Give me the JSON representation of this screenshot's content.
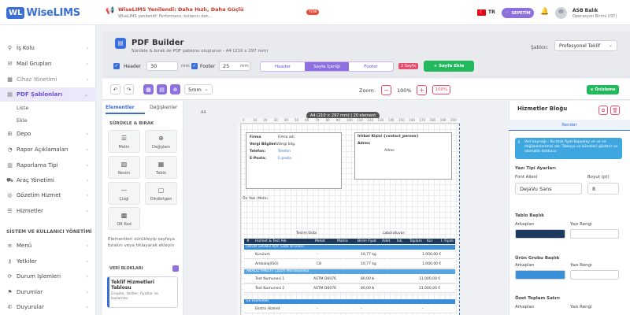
{
  "topbar": {
    "logo_wl": "WL",
    "logo_name": "WiseLIMS",
    "announce_title": "WiseLIMS Yenilendi: Daha Hızlı, Daha Güçlü",
    "announce_sub": "WiseLIMS yenilendi! Performans, kullanıcı den...",
    "new_badge": "YENİ",
    "lang_flag": "☾",
    "lang": "TR",
    "basket_label": "SEPETİM",
    "user_name": "ASB Balık",
    "user_role": "Operasyon Birimi (IST)"
  },
  "sidebar": {
    "items": [
      {
        "icon": "⚲",
        "label": "İş Kolu"
      },
      {
        "icon": "✉",
        "label": "Mail Grupları"
      },
      {
        "icon": "▦",
        "label": "Cihaz Yönetimi"
      },
      {
        "icon": "▤",
        "label": "PDF Şablonları"
      },
      {
        "icon": "⊞",
        "label": "Depo"
      },
      {
        "icon": "◔",
        "label": "Rapor Açıklamaları"
      },
      {
        "icon": "▥",
        "label": "Raporlama Tipi"
      },
      {
        "icon": "⛟",
        "label": "Araç Yönetimi"
      },
      {
        "icon": "◎",
        "label": "Gözetim Hizmet"
      },
      {
        "icon": "☰",
        "label": "Hizmetler"
      },
      {
        "icon": "≡",
        "label": "Menü"
      },
      {
        "icon": "⚷",
        "label": "Yetkiler"
      },
      {
        "icon": "⟳",
        "label": "Durum İşlemleri"
      },
      {
        "icon": "⚑",
        "label": "Durumlar"
      },
      {
        "icon": "✆",
        "label": "Duyurular"
      }
    ],
    "sub_items": [
      "Liste",
      "Ekle"
    ],
    "section": "SİSTEM VE KULLANICI YÖNETİMİ"
  },
  "header": {
    "title": "PDF Builder",
    "subtitle": "Sürükle & bırak ile PDF şablonu oluşturun - A4 (210 x 297 mm)",
    "template_label": "Şablon:",
    "template_value": "Profesyonel Teklif",
    "header_label": "Header",
    "header_value": "30",
    "footer_label": "Footer",
    "footer_value": "25",
    "unit": "mm",
    "seg_header": "Header",
    "seg_content": "Sayfa İçeriği",
    "seg_footer": "Footer",
    "page_badge": "2 Sayfa",
    "add_page": "+ Sayfa Ekle"
  },
  "toolbar": {
    "undo": "↶",
    "redo": "↷",
    "grid": "5mm",
    "zoom_label": "Zoom:",
    "zoom_minus": "−",
    "zoom_value": "100%",
    "zoom_plus": "+",
    "zoom_reset": "100%",
    "preview": "⊙ Önizleme"
  },
  "left_panel": {
    "tab_elements": "Elementler",
    "tab_vars": "Değişkenler",
    "dnd_title": "SÜRÜKLE & BIRAK",
    "tiles": [
      {
        "icon": "☰",
        "label": "Metin"
      },
      {
        "icon": "⊕",
        "label": "Değişken"
      },
      {
        "icon": "▨",
        "label": "Resim"
      },
      {
        "icon": "▦",
        "label": "Tablo"
      },
      {
        "icon": "—",
        "label": "Çizgi"
      },
      {
        "icon": "▢",
        "label": "Dikdörtgen"
      },
      {
        "icon": "▩",
        "label": "QR Kod"
      }
    ],
    "hint": "Elementleri sürükleyip sayfaya bırakın veya tıklayarak ekleyin",
    "blocks_title": "VERİ BLOKLARI",
    "block_title": "Teklif Hizmetleri Tablosu",
    "block_desc": "Gruplar, testler, fiyatlar ve toplamlar"
  },
  "canvas": {
    "page_size": "A4 (210 × 297 mm) | 20 element",
    "a4": "A4",
    "ruler_ticks": [
      "0",
      "10",
      "20",
      "30",
      "40",
      "50",
      "60",
      "70",
      "80",
      "90",
      "100",
      "110",
      "120",
      "130",
      "140",
      "150",
      "160",
      "170",
      "180",
      "190",
      "200"
    ],
    "firma_fields": [
      {
        "k": "Firma",
        "v": "Firma adı"
      },
      {
        "k": "Vergi Bilgileri:",
        "v": "Vergi bilg."
      },
      {
        "k": "Telefon:",
        "v": "Telefon"
      },
      {
        "k": "E-Posta:",
        "v": "E-posta"
      }
    ],
    "contact_title": "İrtibat Kişisi  {contact_person}",
    "contact_adres": "Adres:",
    "contact_adres_val": "Adres",
    "on_yazi": "Ön Yazı: Metni",
    "teslim": "Teslim Ekibi",
    "lab": "Laboratuvar:",
    "table_head": [
      "#",
      "Hizmet & Test Adı",
      "Metot",
      "Matris",
      "Birim Fiyat",
      "Adet",
      "İsk.",
      "Toplam",
      "Kur",
      "İ. Fiyatı"
    ],
    "group1": "ÜRÜN GRUBU ADI: Gıda Ürünleri",
    "group2": "ANALİZ PAKETİ: Lazım Mikrobiyoloji",
    "group3": "Ek Hizmetler",
    "rows": [
      {
        "name": "Kurulum",
        "method": "-",
        "price": "10,77 kg",
        "total": "1.000,00 €"
      },
      {
        "name": "Ambalaj(ISO)",
        "method": "CB",
        "price": "10,77 kg",
        "total": "1.000,00 €"
      },
      {
        "name": "Test Numunesi 1",
        "method": "ASTM D6076",
        "price": "80,00 ₺",
        "total": "11.000,00 €"
      },
      {
        "name": "Test Numunesi 2",
        "method": "ASTM D6076",
        "price": "80,00 ₺",
        "total": "21.000,00 €"
      },
      {
        "name": "Ekstra Hizmet",
        "method": "-",
        "price": "-",
        "total": "-"
      }
    ]
  },
  "right_panel": {
    "title": "Hizmetler Bloğu",
    "tab": "Render",
    "info": "Veri kaynağı – Bu blok fiyat Kopyalay ve ve ve değişkenlerimizi alır. Tabloyu ve kümeleri gösterir ve otomatik doldurur.",
    "font_section": "Yazı Tipi Ayarları",
    "font_family_label": "Font Ailesi",
    "font_family_value": "DejaVu Sans",
    "font_size_label": "Boyut (pt)",
    "font_size_value": "8",
    "table_header_label": "Tablo Başlık",
    "bg_label": "Arkaplan",
    "text_color_label": "Yazı Rengi",
    "group_header_label": "Ürün Grubu Başlık",
    "summary_label": "Özet Toplam Satırı",
    "colors": {
      "table_header_bg": "#1f3a5f",
      "group_bg": "#3b8fd8",
      "accent": "#8e6fe0",
      "success": "#22b85c",
      "danger": "#e74c6c"
    }
  }
}
